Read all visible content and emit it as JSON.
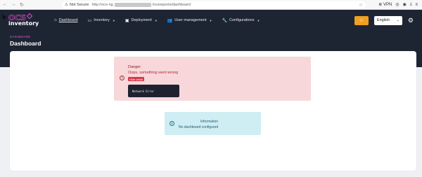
{
  "browser": {
    "back": "←",
    "forward": "→",
    "reload": "↻",
    "secure_label": "Not Secure",
    "url_prefix": "http://ocs-ng.",
    "url_suffix": "/ocsreports/dashboard",
    "vpn_label": "VPN"
  },
  "navbar": {
    "logo_top": "OCS",
    "logo_bottom": "inventory",
    "items": [
      {
        "label": "Dashboard",
        "icon": "home-icon",
        "has_caret": false
      },
      {
        "label": "Inventory",
        "icon": "monitor-icon",
        "has_caret": true
      },
      {
        "label": "Deployment",
        "icon": "box-icon",
        "has_caret": true
      },
      {
        "label": "User management",
        "icon": "users-icon",
        "has_caret": true
      },
      {
        "label": "Configurations",
        "icon": "wrench-icon",
        "has_caret": true
      }
    ],
    "language": "English",
    "accent": "#f0a021"
  },
  "header": {
    "breadcrumb": "DASHBOARD",
    "title": "Dashboard"
  },
  "alerts": {
    "danger": {
      "title": "Danger",
      "message": "Oops, something went wrong",
      "button": "Hide detail",
      "code": "Network Error",
      "color": "#f8d7da"
    },
    "info": {
      "title": "Information",
      "message": "No dashboard configured",
      "color": "#cfeef3"
    }
  }
}
